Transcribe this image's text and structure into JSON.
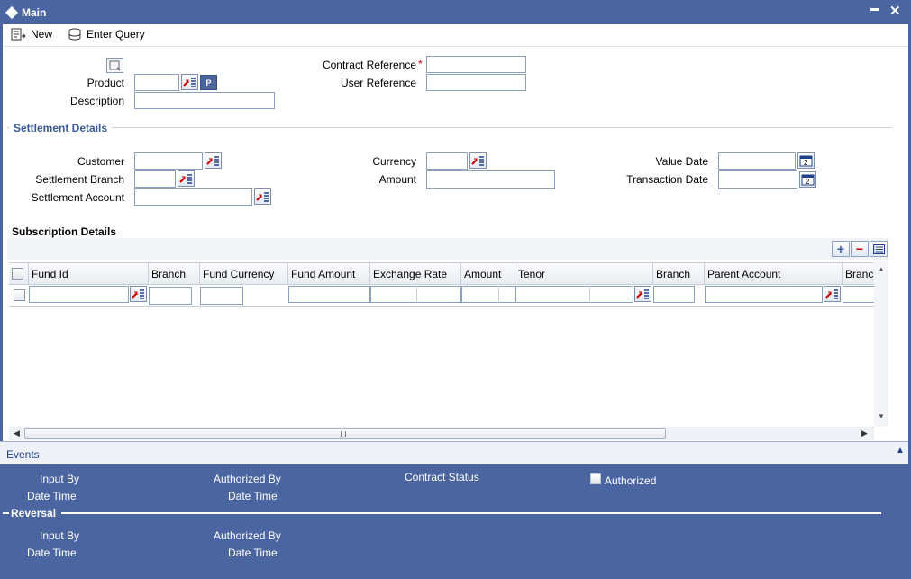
{
  "window": {
    "title": "Main",
    "minimize_label": "▬",
    "close_label": "✕"
  },
  "toolbar": {
    "new_label": "New",
    "enter_query_label": "Enter Query"
  },
  "header": {
    "product_label": "Product",
    "description_label": "Description",
    "contract_reference_label": "Contract Reference",
    "required_mark": "*",
    "user_reference_label": "User Reference",
    "product_button_label": "P"
  },
  "settlement": {
    "title": "Settlement Details",
    "customer_label": "Customer",
    "settlement_branch_label": "Settlement Branch",
    "settlement_account_label": "Settlement Account",
    "currency_label": "Currency",
    "amount_label": "Amount",
    "value_date_label": "Value Date",
    "transaction_date_label": "Transaction Date"
  },
  "subscription": {
    "title": "Subscription Details",
    "add_label": "+",
    "remove_label": "−",
    "columns": [
      "Fund Id",
      "Branch",
      "Fund Currency",
      "Fund Amount",
      "Exchange Rate",
      "Amount",
      "Tenor",
      "Branch",
      "Parent Account",
      "Branc"
    ]
  },
  "footer": {
    "events_label": "Events",
    "input_by_label": "Input By",
    "date_time_label": "Date Time",
    "authorized_by_label": "Authorized By",
    "contract_status_label": "Contract Status",
    "authorized_label": "Authorized",
    "reversal_label": "Reversal"
  },
  "colors": {
    "chrome": "#4a659f",
    "section_title": "#3a5a99",
    "required": "#cc0000"
  },
  "icons": [
    "new-icon",
    "enter-query-icon",
    "lov-icon",
    "calendar-icon",
    "add-row-icon",
    "delete-row-icon",
    "single-view-icon"
  ]
}
